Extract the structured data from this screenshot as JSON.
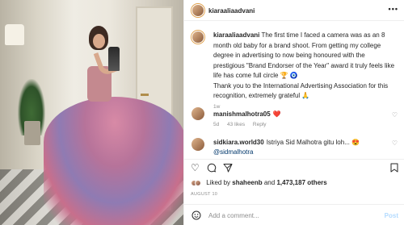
{
  "post": {
    "username": "kiaraaliaadvani",
    "caption_lines": [
      "The first time I faced a camera was as an 8",
      "month old baby for a brand shoot. From getting my college",
      "degree in advertising to now being honoured with the",
      "prestigious \"Brand Endorser of the Year\" award it truly feels like",
      "life has come full circle 🏆 🧿",
      "Thank you to the International Advertising Association for this",
      "recognition, extremely grateful 🙏"
    ],
    "time_ago": "1w"
  },
  "comments": [
    {
      "username": "manishmalhotra05",
      "text": "❤️",
      "time": "5d",
      "likes": "43 likes",
      "reply": "Reply"
    },
    {
      "username": "sidkiara.world30",
      "text": "Istriya Sid Malhotra gitu loh... 😍",
      "mention": "@sidmalhotra"
    }
  ],
  "likes": {
    "prefix": "Liked by",
    "user": "shaheenb",
    "and": "and",
    "others": "1,473,187 others"
  },
  "date": "AUGUST 10",
  "add_comment": {
    "placeholder": "Add a comment...",
    "post_label": "Post"
  },
  "icons": {
    "more": "more-icon",
    "heart": "heart-icon",
    "comment": "comment-icon",
    "share": "share-icon",
    "save": "bookmark-icon",
    "emoji": "emoji-icon"
  }
}
